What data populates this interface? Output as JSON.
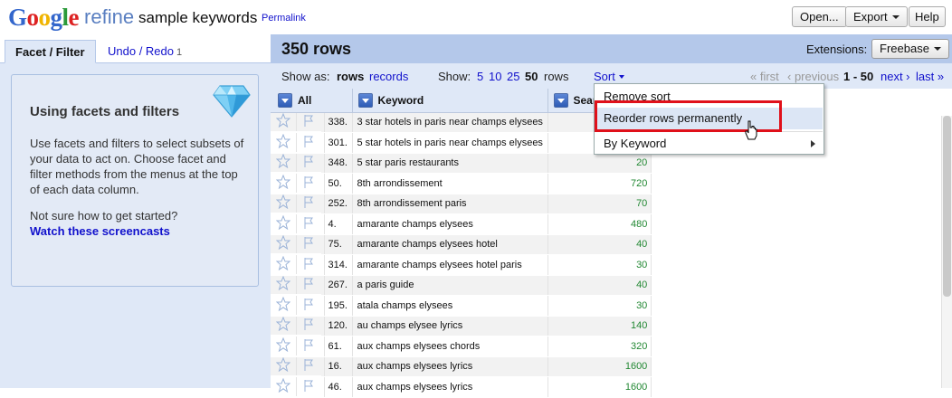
{
  "header": {
    "logo_letters": [
      {
        "ch": "G",
        "color": "#3366cc"
      },
      {
        "ch": "o",
        "color": "#dd2222"
      },
      {
        "ch": "o",
        "color": "#f0b400"
      },
      {
        "ch": "g",
        "color": "#3366cc"
      },
      {
        "ch": "l",
        "color": "#2b9a3a"
      },
      {
        "ch": "e",
        "color": "#dd2222"
      }
    ],
    "logo_suffix": "refine",
    "project_name": "sample keywords",
    "permalink": "Permalink",
    "open_label": "Open...",
    "export_label": "Export",
    "help_label": "Help"
  },
  "left": {
    "tab_facet": "Facet / Filter",
    "tab_undo": "Undo / Redo",
    "undo_count": "1",
    "help_title": "Using facets and filters",
    "help_text": "Use facets and filters to select subsets of your data to act on. Choose facet and filter methods from the menus at the top of each data column.",
    "help_question": "Not sure how to get started?",
    "help_link": "Watch these screencasts"
  },
  "summary": {
    "row_count": "350 rows",
    "extensions_label": "Extensions:",
    "extensions_value": "Freebase"
  },
  "viewbar": {
    "show_as": "Show as:",
    "rows": "rows",
    "records": "records",
    "show": "Show:",
    "sizes": [
      "5",
      "10",
      "25"
    ],
    "current_size": "50",
    "rows_word": "rows",
    "sort": "Sort",
    "first": "« first",
    "previous": "‹ previous",
    "range": "1 - 50",
    "next": "next ›",
    "last": "last »"
  },
  "columns": {
    "all": "All",
    "keyword": "Keyword",
    "search": "Search Volume"
  },
  "rows": [
    {
      "index": "338.",
      "keyword": "3 star hotels in paris near champs elysees",
      "volume": ""
    },
    {
      "index": "301.",
      "keyword": "5 star hotels in paris near champs elysees",
      "volume": ""
    },
    {
      "index": "348.",
      "keyword": "5 star paris restaurants",
      "volume": "20"
    },
    {
      "index": "50.",
      "keyword": "8th arrondissement",
      "volume": "720"
    },
    {
      "index": "252.",
      "keyword": "8th arrondissement paris",
      "volume": "70"
    },
    {
      "index": "4.",
      "keyword": "amarante champs elysees",
      "volume": "480"
    },
    {
      "index": "75.",
      "keyword": "amarante champs elysees hotel",
      "volume": "40"
    },
    {
      "index": "314.",
      "keyword": "amarante champs elysees hotel paris",
      "volume": "30"
    },
    {
      "index": "267.",
      "keyword": "a paris guide",
      "volume": "40"
    },
    {
      "index": "195.",
      "keyword": "atala champs elysees",
      "volume": "30"
    },
    {
      "index": "120.",
      "keyword": "au champs elysee lyrics",
      "volume": "140"
    },
    {
      "index": "61.",
      "keyword": "aux champs elysees chords",
      "volume": "320"
    },
    {
      "index": "16.",
      "keyword": "aux champs elysees lyrics",
      "volume": "1600"
    },
    {
      "index": "46.",
      "keyword": "aux champs elysees lyrics",
      "volume": "1600"
    }
  ],
  "sort_menu": {
    "remove_sort": "Remove sort",
    "reorder": "Reorder rows permanently",
    "by_keyword": "By Keyword"
  }
}
